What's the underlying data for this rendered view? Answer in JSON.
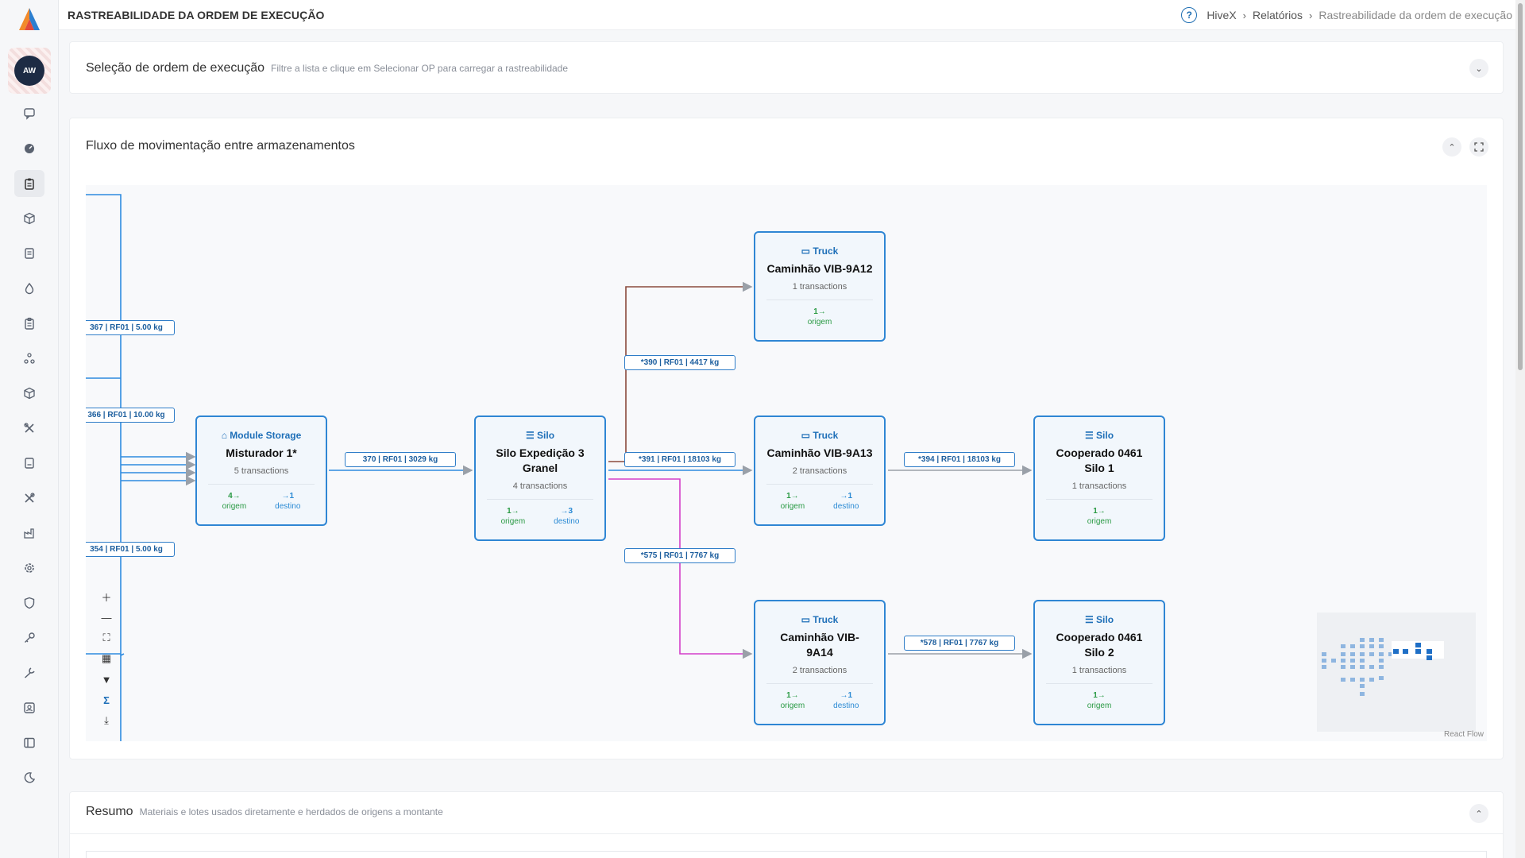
{
  "header": {
    "title": "RASTREABILIDADE DA ORDEM DE EXECUÇÃO",
    "breadcrumb": [
      "HiveX",
      "Relatórios",
      "Rastreabilidade da ordem de execução"
    ]
  },
  "sidebar": {
    "avatar_initials": "AW",
    "icons": [
      "chat-icon",
      "dashboard-icon",
      "clipboard-icon",
      "package-icon",
      "document-icon",
      "drop-icon",
      "clipboard-list-icon",
      "nodes-icon",
      "box-icon",
      "tools-icon",
      "report-icon",
      "tools-alt-icon",
      "factory-icon",
      "settings-icon",
      "shield-icon",
      "key-icon",
      "wrench-icon",
      "user-badge-icon",
      "sidebar-toggle-icon",
      "moon-icon"
    ],
    "active_index": 2
  },
  "sections": {
    "selection": {
      "title": "Seleção de ordem de execução",
      "subtitle": "Filtre a lista e clique em Selecionar OP para carregar a rastreabilidade"
    },
    "flow": {
      "title": "Fluxo de movimentação entre armazenamentos"
    },
    "summary": {
      "title": "Resumo",
      "subtitle": "Materiais e lotes usados diretamente e herdados de origens a montante"
    }
  },
  "flow": {
    "nodes": {
      "misturador": {
        "type": "Module Storage",
        "name": "Misturador 1*",
        "transactions": "5 transactions",
        "origem": "4→",
        "destino": "→1",
        "origem_label": "origem",
        "destino_label": "destino"
      },
      "silo_exp": {
        "type": "Silo",
        "name": "Silo Expedição 3 Granel",
        "transactions": "4 transactions",
        "origem": "1→",
        "destino": "→3",
        "origem_label": "origem",
        "destino_label": "destino"
      },
      "truck_12": {
        "type": "Truck",
        "name": "Caminhão VIB-9A12",
        "transactions": "1 transactions",
        "origem": "1→",
        "origem_label": "origem"
      },
      "truck_13": {
        "type": "Truck",
        "name": "Caminhão VIB-9A13",
        "transactions": "2 transactions",
        "origem": "1→",
        "destino": "→1",
        "origem_label": "origem",
        "destino_label": "destino"
      },
      "truck_14": {
        "type": "Truck",
        "name": "Caminhão VIB-9A14",
        "transactions": "2 transactions",
        "origem": "1→",
        "destino": "→1",
        "origem_label": "origem",
        "destino_label": "destino"
      },
      "coop_1": {
        "type": "Silo",
        "name": "Cooperado 0461 Silo 1",
        "transactions": "1 transactions",
        "origem": "1→",
        "origem_label": "origem"
      },
      "coop_2": {
        "type": "Silo",
        "name": "Cooperado 0461 Silo 2",
        "transactions": "1 transactions",
        "origem": "1→",
        "origem_label": "origem"
      }
    },
    "edges": {
      "e367": "367 | RF01 | 5.00 kg",
      "e366": "366 | RF01 | 10.00 kg",
      "e354": "354 | RF01 | 5.00 kg",
      "e370": "370 | RF01 | 3029 kg",
      "e390": "*390 | RF01 | 4417 kg",
      "e391": "*391 | RF01 | 18103 kg",
      "e575": "*575 | RF01 | 7767 kg",
      "e394": "*394 | RF01 | 18103 kg",
      "e578": "*578 | RF01 | 7767 kg"
    },
    "attribution": "React Flow",
    "controls": [
      "zoom-in-icon",
      "zoom-out-icon",
      "fit-view-icon",
      "grid-icon",
      "filter-icon",
      "sigma-icon",
      "download-icon"
    ]
  },
  "colors": {
    "accent": "#2f86d4",
    "origem": "#2a9a44",
    "destino": "#2a8ad4",
    "edge_brown": "#8b4a3c",
    "edge_magenta": "#d43fc9"
  }
}
